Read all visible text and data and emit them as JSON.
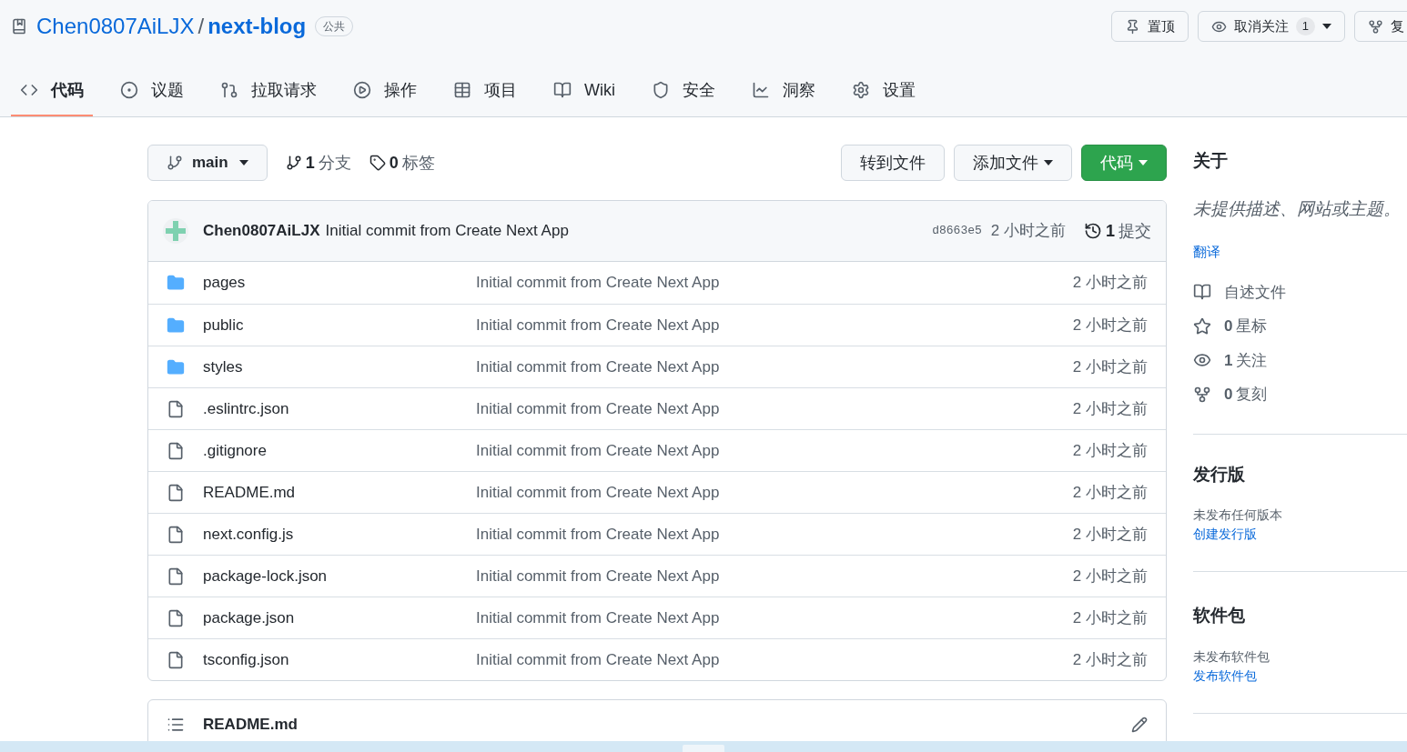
{
  "repo": {
    "owner": "Chen0807AiLJX",
    "separator": "/",
    "name": "next-blog",
    "visibility": "公共"
  },
  "header_actions": [
    {
      "label": "置顶"
    },
    {
      "label": "取消关注",
      "count": "1"
    },
    {
      "label": "复"
    }
  ],
  "tabs": [
    {
      "label": "代码",
      "selected": true
    },
    {
      "label": "议题",
      "selected": false
    },
    {
      "label": "拉取请求",
      "selected": false
    },
    {
      "label": "操作",
      "selected": false
    },
    {
      "label": "项目",
      "selected": false
    },
    {
      "label": "Wiki",
      "selected": false
    },
    {
      "label": "安全",
      "selected": false
    },
    {
      "label": "洞察",
      "selected": false
    },
    {
      "label": "设置",
      "selected": false
    }
  ],
  "branch_bar": {
    "branch": "main",
    "branches_count": "1",
    "branches_label": "分支",
    "tags_count": "0",
    "tags_label": "标签",
    "go_to_file": "转到文件",
    "add_file": "添加文件",
    "code": "代码"
  },
  "latest_commit": {
    "author": "Chen0807AiLJX",
    "message": "Initial commit from Create Next App",
    "sha": "d8663e5",
    "time": "2 小时之前",
    "commits_count": "1",
    "commits_label": "提交"
  },
  "files": [
    {
      "kind": "folder",
      "name": "pages",
      "message": "Initial commit from Create Next App",
      "time": "2 小时之前"
    },
    {
      "kind": "folder",
      "name": "public",
      "message": "Initial commit from Create Next App",
      "time": "2 小时之前"
    },
    {
      "kind": "folder",
      "name": "styles",
      "message": "Initial commit from Create Next App",
      "time": "2 小时之前"
    },
    {
      "kind": "file",
      "name": ".eslintrc.json",
      "message": "Initial commit from Create Next App",
      "time": "2 小时之前"
    },
    {
      "kind": "file",
      "name": ".gitignore",
      "message": "Initial commit from Create Next App",
      "time": "2 小时之前"
    },
    {
      "kind": "file",
      "name": "README.md",
      "message": "Initial commit from Create Next App",
      "time": "2 小时之前"
    },
    {
      "kind": "file",
      "name": "next.config.js",
      "message": "Initial commit from Create Next App",
      "time": "2 小时之前"
    },
    {
      "kind": "file",
      "name": "package-lock.json",
      "message": "Initial commit from Create Next App",
      "time": "2 小时之前"
    },
    {
      "kind": "file",
      "name": "package.json",
      "message": "Initial commit from Create Next App",
      "time": "2 小时之前"
    },
    {
      "kind": "file",
      "name": "tsconfig.json",
      "message": "Initial commit from Create Next App",
      "time": "2 小时之前"
    }
  ],
  "readme": {
    "title": "README.md"
  },
  "about": {
    "title": "关于",
    "description": "未提供描述、网站或主题。",
    "translate": "翻译",
    "stats": [
      {
        "label": "自述文件"
      },
      {
        "count": "0",
        "label": "星标"
      },
      {
        "count": "1",
        "label": "关注"
      },
      {
        "count": "0",
        "label": "复刻"
      }
    ]
  },
  "releases": {
    "title": "发行版",
    "empty": "未发布任何版本",
    "link": "创建发行版"
  },
  "packages": {
    "title": "软件包",
    "empty": "未发布软件包",
    "link": "发布软件包"
  }
}
